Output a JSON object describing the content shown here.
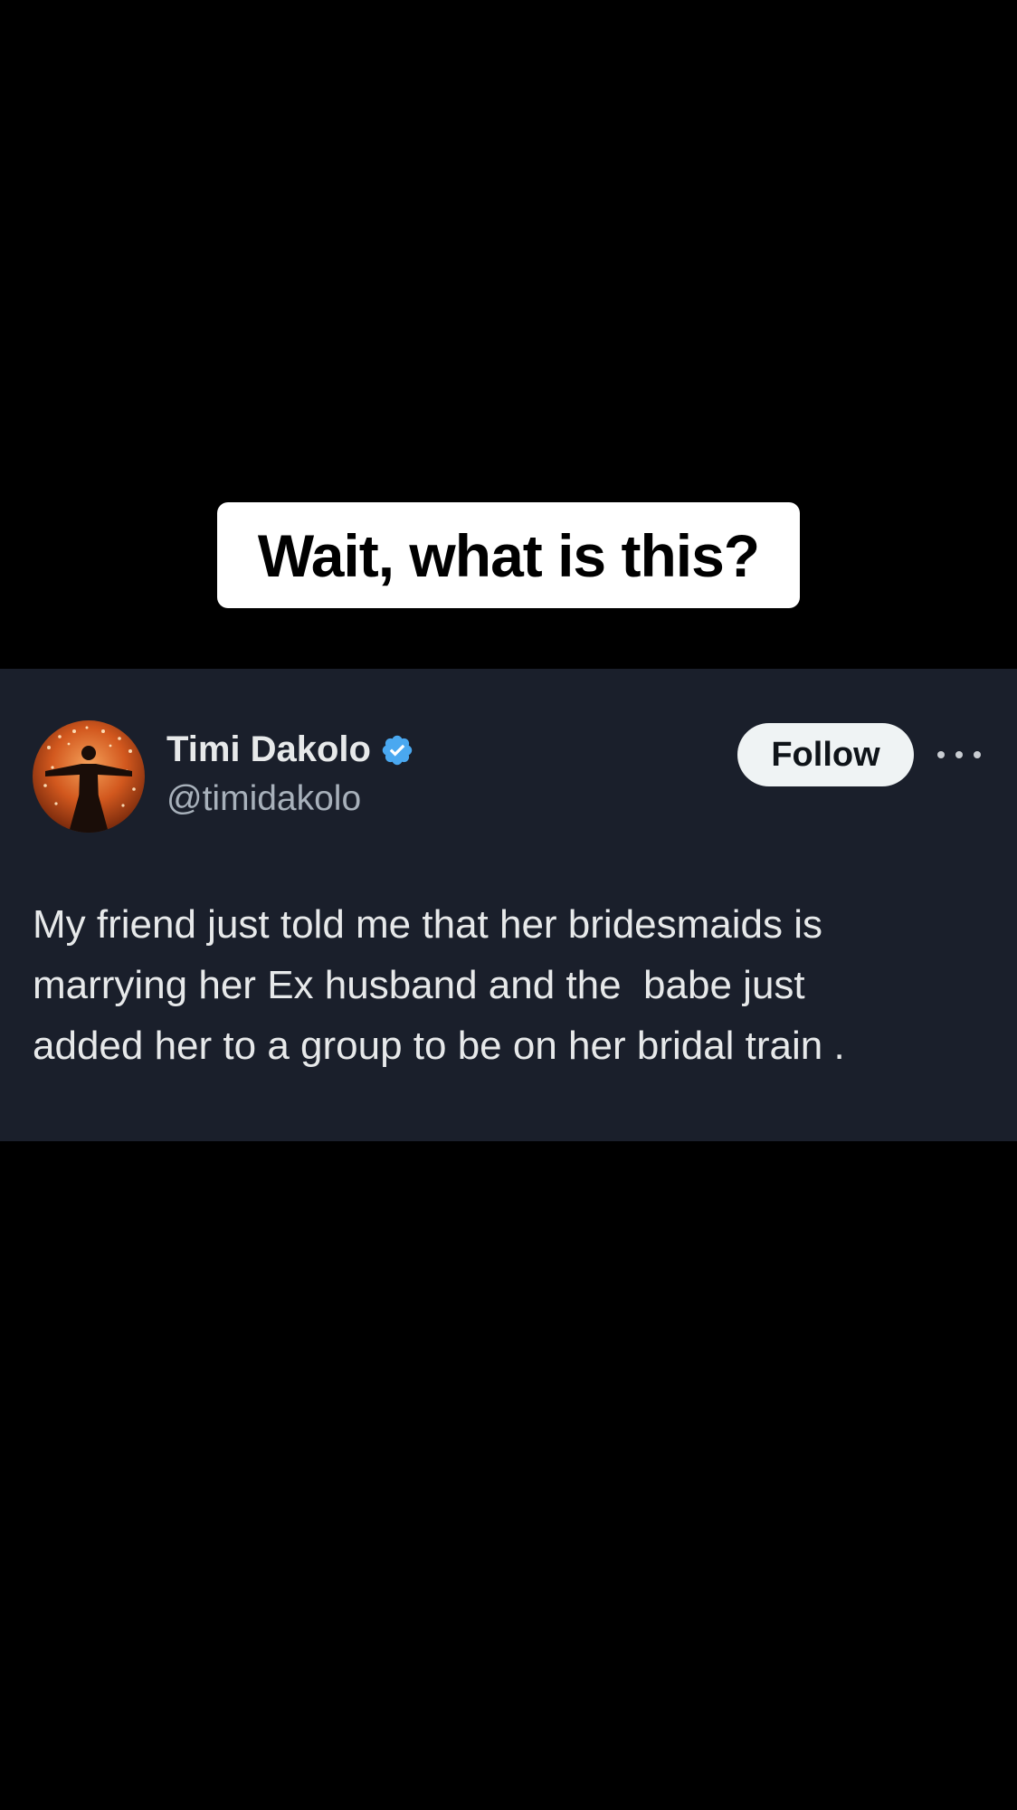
{
  "caption": {
    "text": "Wait, what is this?"
  },
  "tweet": {
    "display_name": "Timi Dakolo",
    "handle": "@timidakolo",
    "verified": true,
    "verified_icon": "verified-badge-icon",
    "follow_label": "Follow",
    "more_icon": "more-options-icon",
    "body": "My friend just told me that her bridesmaids is\nmarrying her Ex husband and the  babe just\nadded her to a group to be on her bridal train .",
    "colors": {
      "card_background": "#1a1f2b",
      "verified_blue": "#4aa8f0",
      "follow_button_bg": "#eff3f4"
    }
  }
}
